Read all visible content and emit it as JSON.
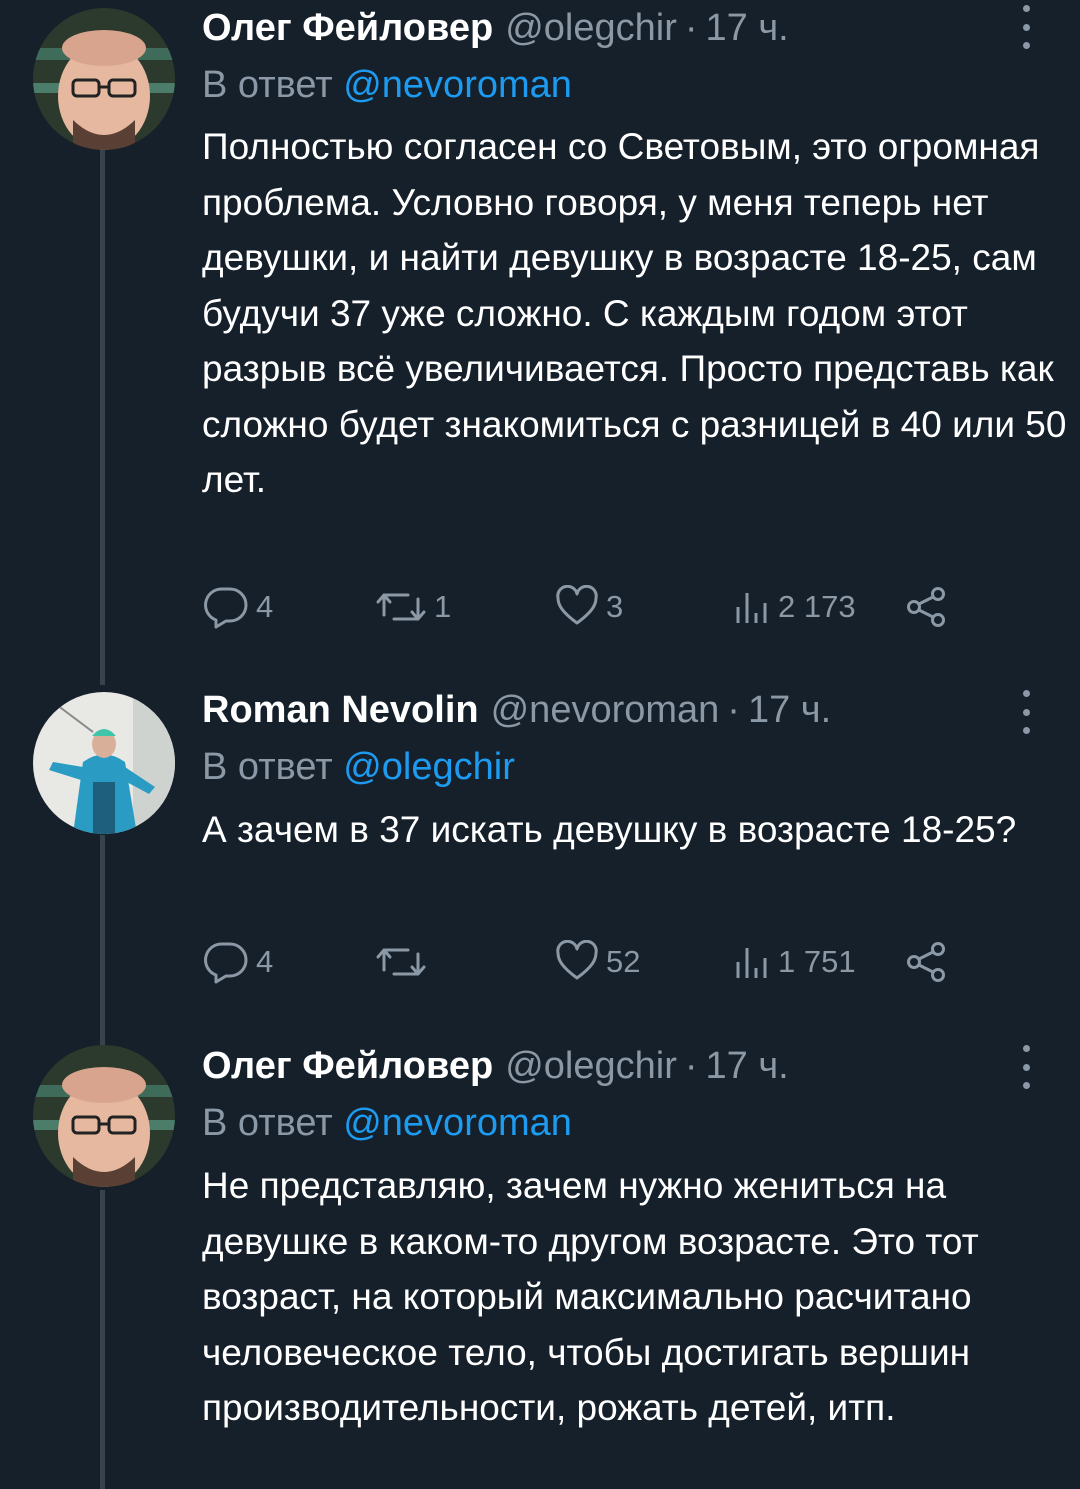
{
  "tweets": [
    {
      "author_name": "Олег Фейловер",
      "handle": "@olegchir",
      "separator": "·",
      "time": "17 ч.",
      "reply_prefix": "В ответ",
      "reply_mention": "@nevoroman",
      "text": "Полностью согласен со Световым, это огромная проблема. Условно говоря, у меня теперь нет девушки, и найти девушку в возрасте 18-25, сам будучи 37 уже сложно. С каждым годом этот разрыв всё увеличивается. Просто представь как сложно будет знакомиться с разницей в 40 или 50 лет.",
      "replies": "4",
      "retweets": "1",
      "likes": "3",
      "views": "2 173"
    },
    {
      "author_name": "Roman Nevolin",
      "handle": "@nevoroman",
      "separator": "·",
      "time": "17 ч.",
      "reply_prefix": "В ответ",
      "reply_mention": "@olegchir",
      "text": "А зачем в 37 искать девушку в возрасте 18-25?",
      "replies": "4",
      "retweets": "",
      "likes": "52",
      "views": "1 751"
    },
    {
      "author_name": "Олег Фейловер",
      "handle": "@olegchir",
      "separator": "·",
      "time": "17 ч.",
      "reply_prefix": "В ответ",
      "reply_mention": "@nevoroman",
      "text": "Не представляю, зачем нужно жениться на девушке в каком-то другом возрасте. Это тот возраст, на который максимально расчитано человеческое тело, чтобы достигать вершин производительности, рожать детей, итп."
    }
  ],
  "colors": {
    "background": "#15202b",
    "text_primary": "#ffffff",
    "text_secondary": "#8b98a5",
    "link": "#1d9bf0",
    "thread_line": "#38444d"
  },
  "icons": [
    "reply-icon",
    "retweet-icon",
    "like-icon",
    "views-icon",
    "share-icon",
    "more-icon"
  ]
}
